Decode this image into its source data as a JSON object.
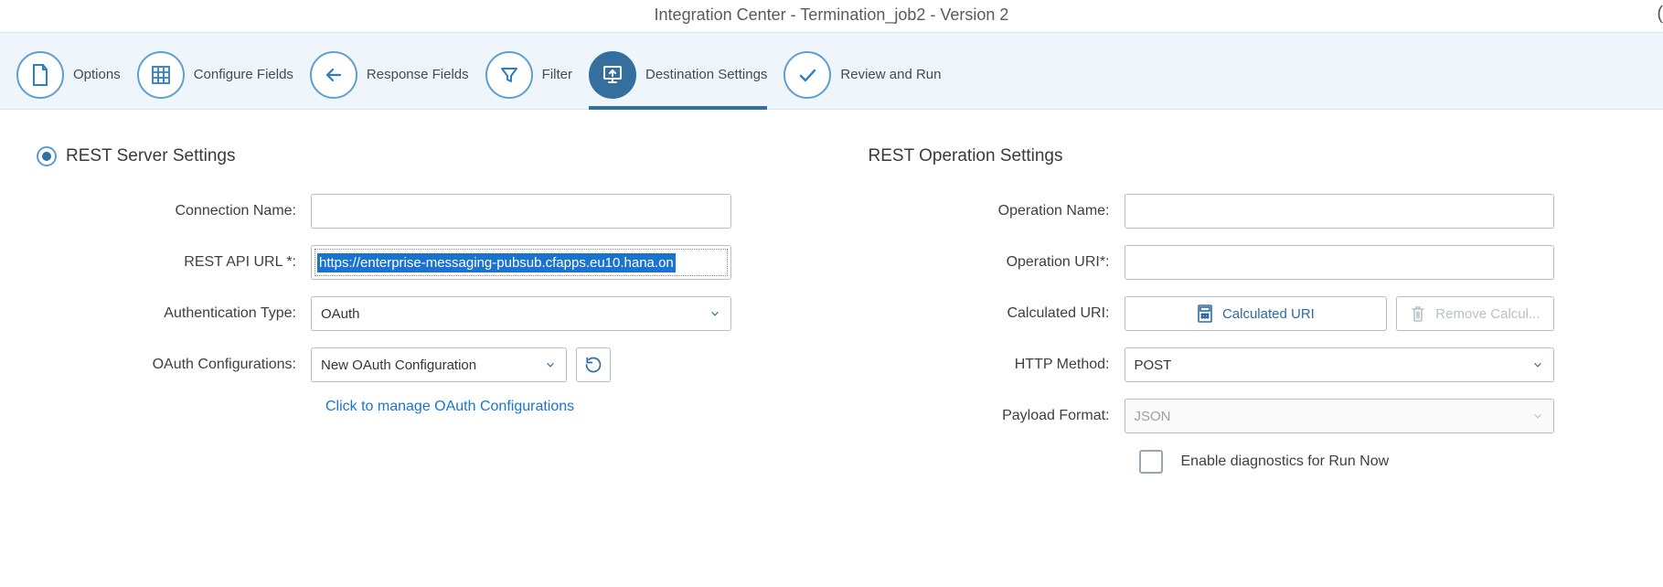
{
  "header": {
    "title": "Integration Center - Termination_job2 - Version 2"
  },
  "steps": [
    {
      "id": "options",
      "label": "Options",
      "active": false,
      "icon": "page"
    },
    {
      "id": "configure-fields",
      "label": "Configure Fields",
      "active": false,
      "icon": "grid"
    },
    {
      "id": "response-fields",
      "label": "Response Fields",
      "active": false,
      "icon": "arrow-left"
    },
    {
      "id": "filter",
      "label": "Filter",
      "active": false,
      "icon": "funnel"
    },
    {
      "id": "destination-settings",
      "label": "Destination Settings",
      "active": true,
      "icon": "upload-monitor"
    },
    {
      "id": "review-run",
      "label": "Review and Run",
      "active": false,
      "icon": "check"
    }
  ],
  "left": {
    "section_title": "REST Server Settings",
    "radio_selected": true,
    "fields": {
      "connection_name": {
        "label": "Connection Name:",
        "value": ""
      },
      "rest_api_url": {
        "label": "REST API URL *:",
        "value": "https://enterprise-messaging-pubsub.cfapps.eu10.hana.on"
      },
      "auth_type": {
        "label": "Authentication Type:",
        "value": "OAuth"
      },
      "oauth_config": {
        "label": "OAuth Configurations:",
        "value": "New OAuth Configuration"
      }
    },
    "manage_link": "Click to manage OAuth Configurations"
  },
  "right": {
    "section_title": "REST Operation Settings",
    "fields": {
      "operation_name": {
        "label": "Operation Name:",
        "value": ""
      },
      "operation_uri": {
        "label": "Operation URI*:",
        "value": ""
      },
      "calculated_uri": {
        "label": "Calculated URI:",
        "button": "Calculated URI",
        "remove": "Remove Calcul..."
      },
      "http_method": {
        "label": "HTTP Method:",
        "value": "POST"
      },
      "payload_format": {
        "label": "Payload Format:",
        "value": "JSON"
      }
    },
    "diagnostics": {
      "label": "Enable diagnostics for Run Now",
      "checked": false
    }
  }
}
